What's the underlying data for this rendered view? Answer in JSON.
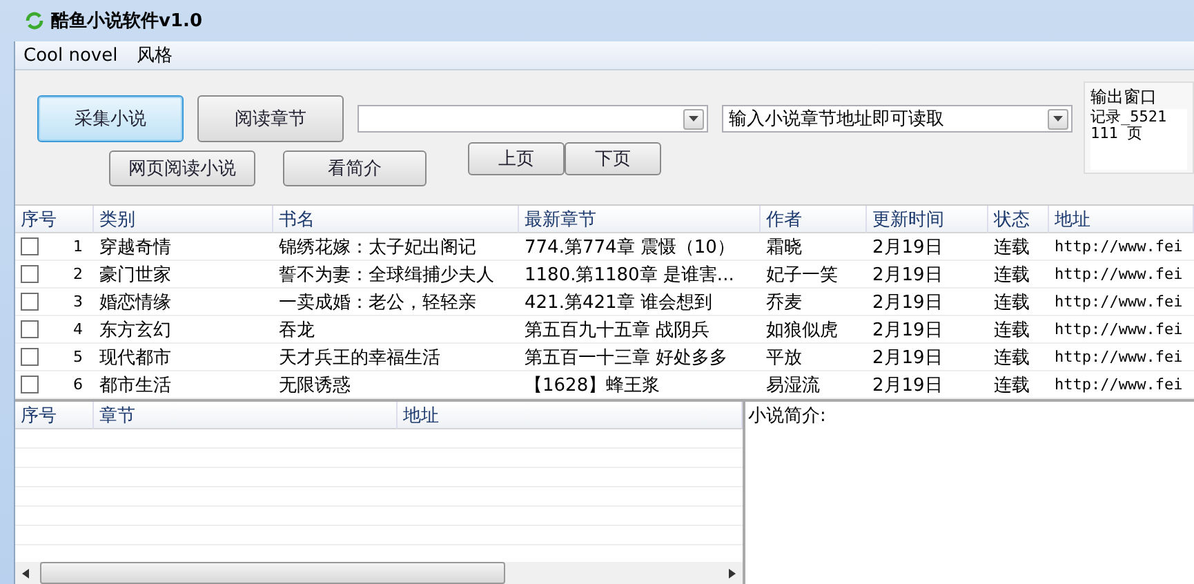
{
  "window": {
    "title": "酷鱼小说软件v1.0"
  },
  "menu": [
    "Cool novel",
    "风格"
  ],
  "toolbar": {
    "buttons_row1": [
      {
        "label": "采集小说",
        "selected": true
      },
      {
        "label": "阅读章节",
        "selected": false
      }
    ],
    "buttons_row2": [
      {
        "label": "网页阅读小说",
        "selected": false
      },
      {
        "label": "看简介",
        "selected": false
      }
    ],
    "page_buttons": [
      "上页",
      "下页"
    ],
    "combo_2": {
      "value": "输入小说章节地址即可读取"
    }
  },
  "output_panel": {
    "title": "输出窗口",
    "lines": [
      "记录_5521",
      "111 页"
    ]
  },
  "novel_table": {
    "columns": [
      "序号",
      "类别",
      "书名",
      "最新章节",
      "作者",
      "更新时间",
      "状态",
      "地址"
    ],
    "rows": [
      {
        "checked": false,
        "index": "1",
        "category": "穿越奇情",
        "title": "锦绣花嫁：太子妃出阁记",
        "latest": "774.第774章 震慑（10）",
        "author": "霜晓",
        "updated": "2月19日",
        "status": "连载",
        "url": "http://www.fei"
      },
      {
        "checked": false,
        "index": "2",
        "category": "豪门世家",
        "title": "誓不为妻：全球缉捕少夫人",
        "latest": "1180.第1180章 是谁害...",
        "author": "妃子一笑",
        "updated": "2月19日",
        "status": "连载",
        "url": "http://www.fei"
      },
      {
        "checked": false,
        "index": "3",
        "category": "婚恋情缘",
        "title": "一卖成婚：老公，轻轻亲",
        "latest": "421.第421章 谁会想到",
        "author": "乔麦",
        "updated": "2月19日",
        "status": "连载",
        "url": "http://www.fei"
      },
      {
        "checked": false,
        "index": "4",
        "category": "东方玄幻",
        "title": "吞龙",
        "latest": "第五百九十五章 战阴兵",
        "author": "如狼似虎",
        "updated": "2月19日",
        "status": "连载",
        "url": "http://www.fei"
      },
      {
        "checked": false,
        "index": "5",
        "category": "现代都市",
        "title": "天才兵王的幸福生活",
        "latest": "第五百一十三章 好处多多",
        "author": "平放",
        "updated": "2月19日",
        "status": "连载",
        "url": "http://www.fei"
      },
      {
        "checked": false,
        "index": "6",
        "category": "都市生活",
        "title": "无限诱惑",
        "latest": "【1628】蜂王浆",
        "author": "易湿流",
        "updated": "2月19日",
        "status": "连载",
        "url": "http://www.fei"
      }
    ]
  },
  "chapter_table": {
    "columns": [
      "序号",
      "章节",
      "地址"
    ]
  },
  "summary_panel": {
    "label": "小说简介:"
  }
}
